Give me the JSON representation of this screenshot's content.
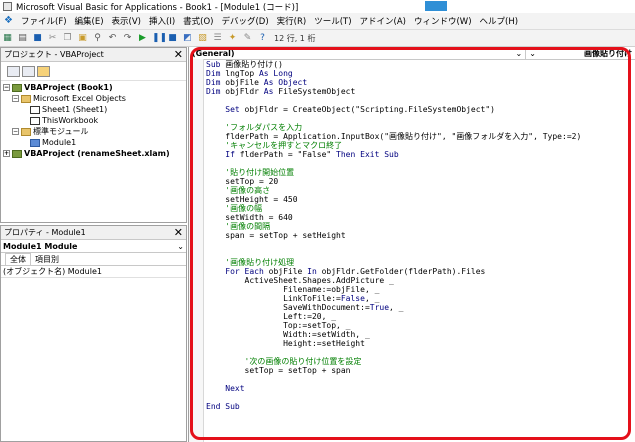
{
  "window": {
    "title": "Microsoft Visual Basic for Applications - Book1 - [Module1 (コード)]"
  },
  "menu": [
    "ファイル(F)",
    "編集(E)",
    "表示(V)",
    "挿入(I)",
    "書式(O)",
    "デバッグ(D)",
    "実行(R)",
    "ツール(T)",
    "アドイン(A)",
    "ウィンドウ(W)",
    "ヘルプ(H)"
  ],
  "toolbar": {
    "position": "12 行, 1 桁"
  },
  "project": {
    "title": "プロジェクト - VBAProject",
    "tree": [
      {
        "label": "VBAProject (Book1)",
        "level": 0,
        "icon": "proj",
        "expander": "−",
        "bold": true
      },
      {
        "label": "Microsoft Excel Objects",
        "level": 1,
        "icon": "folder",
        "expander": "−",
        "bold": false
      },
      {
        "label": "Sheet1 (Sheet1)",
        "level": 2,
        "icon": "sheet",
        "expander": "",
        "bold": false
      },
      {
        "label": "ThisWorkbook",
        "level": 2,
        "icon": "sheet",
        "expander": "",
        "bold": false
      },
      {
        "label": "標準モジュール",
        "level": 1,
        "icon": "folder",
        "expander": "−",
        "bold": false
      },
      {
        "label": "Module1",
        "level": 2,
        "icon": "mod",
        "expander": "",
        "bold": false
      },
      {
        "label": "VBAProject (renameSheet.xlam)",
        "level": 0,
        "icon": "proj",
        "expander": "+",
        "bold": true
      }
    ]
  },
  "properties": {
    "title": "プロパティ - Module1",
    "selector": "Module1 Module",
    "tabs": [
      "全体",
      "項目別"
    ],
    "row": "(オブジェクト名) Module1"
  },
  "code": {
    "object_combo": "(General)",
    "proc_combo": "画像貼り付け",
    "lines": [
      [
        [
          "kw",
          "Sub "
        ],
        [
          "t",
          "画像貼り付け()"
        ]
      ],
      [
        [
          "kw",
          "Dim "
        ],
        [
          "t",
          "lngTop "
        ],
        [
          "kw",
          "As Long"
        ]
      ],
      [
        [
          "kw",
          "Dim "
        ],
        [
          "t",
          "objFile "
        ],
        [
          "kw",
          "As Object"
        ]
      ],
      [
        [
          "kw",
          "Dim "
        ],
        [
          "t",
          "objFldr "
        ],
        [
          "kw",
          "As "
        ],
        [
          "t",
          "FileSystemObject"
        ]
      ],
      [],
      [
        [
          "kw",
          "    Set "
        ],
        [
          "t",
          "objFldr = CreateObject(\"Scripting.FileSystemObject\")"
        ]
      ],
      [],
      [
        [
          "cm",
          "    'フォルダパスを入力"
        ]
      ],
      [
        [
          "t",
          "    flderPath = Application.InputBox(\"画像貼り付け\", \"画像フォルダを入力\", Type:=2)"
        ]
      ],
      [
        [
          "cm",
          "    'キャンセルを押すとマクロ終了"
        ]
      ],
      [
        [
          "kw",
          "    If "
        ],
        [
          "t",
          "flderPath = \"False\" "
        ],
        [
          "kw",
          "Then Exit Sub"
        ]
      ],
      [],
      [
        [
          "cm",
          "    '貼り付け開始位置"
        ]
      ],
      [
        [
          "t",
          "    setTop = 20"
        ]
      ],
      [
        [
          "cm",
          "    '画像の高さ"
        ]
      ],
      [
        [
          "t",
          "    setHeight = 450"
        ]
      ],
      [
        [
          "cm",
          "    '画像の幅"
        ]
      ],
      [
        [
          "t",
          "    setWidth = 640"
        ]
      ],
      [
        [
          "cm",
          "    '画像の間隔"
        ]
      ],
      [
        [
          "t",
          "    span = setTop + setHeight"
        ]
      ],
      [],
      [],
      [
        [
          "cm",
          "    '画像貼り付け処理"
        ]
      ],
      [
        [
          "kw",
          "    For Each "
        ],
        [
          "t",
          "objFile "
        ],
        [
          "kw",
          "In "
        ],
        [
          "t",
          "objFldr.GetFolder(flderPath).Files"
        ]
      ],
      [
        [
          "t",
          "        ActiveSheet.Shapes.AddPicture _"
        ]
      ],
      [
        [
          "t",
          "                Filename:=objFile, _"
        ]
      ],
      [
        [
          "t",
          "                LinkToFile:="
        ],
        [
          "kw",
          "False"
        ],
        [
          "t",
          ", _"
        ]
      ],
      [
        [
          "t",
          "                SaveWithDocument:="
        ],
        [
          "kw",
          "True"
        ],
        [
          "t",
          ", _"
        ]
      ],
      [
        [
          "t",
          "                Left:=20, _"
        ]
      ],
      [
        [
          "t",
          "                Top:=setTop, _"
        ]
      ],
      [
        [
          "t",
          "                Width:=setWidth, _"
        ]
      ],
      [
        [
          "t",
          "                Height:=setHeight"
        ]
      ],
      [],
      [
        [
          "cm",
          "        '次の画像の貼り付け位置を設定"
        ]
      ],
      [
        [
          "t",
          "        setTop = setTop + span"
        ]
      ],
      [],
      [
        [
          "kw",
          "    Next"
        ]
      ],
      [],
      [
        [
          "kw",
          "End Sub"
        ]
      ]
    ]
  }
}
